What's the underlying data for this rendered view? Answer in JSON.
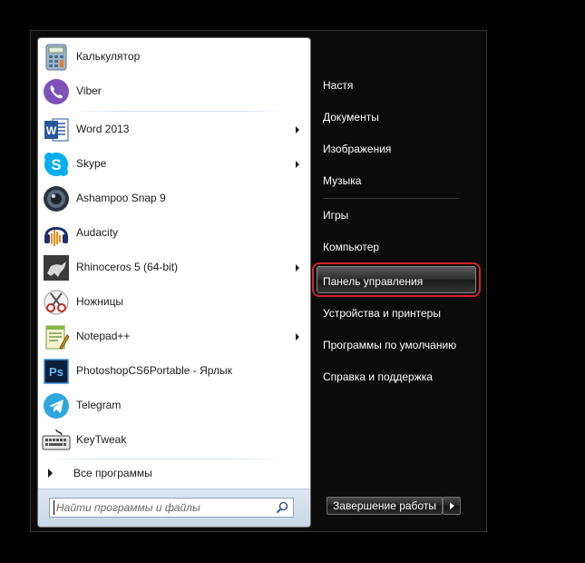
{
  "programs": [
    {
      "label": "Калькулятор",
      "icon": "calculator-icon",
      "submenu": false
    },
    {
      "label": "Viber",
      "icon": "viber-icon",
      "submenu": false
    },
    {
      "label": "Word 2013",
      "icon": "word-icon",
      "submenu": true
    },
    {
      "label": "Skype",
      "icon": "skype-icon",
      "submenu": true
    },
    {
      "label": "Ashampoo Snap 9",
      "icon": "ashampoo-snap-icon",
      "submenu": false
    },
    {
      "label": "Audacity",
      "icon": "audacity-icon",
      "submenu": false
    },
    {
      "label": "Rhinoceros 5 (64-bit)",
      "icon": "rhinoceros-icon",
      "submenu": true
    },
    {
      "label": "Ножницы",
      "icon": "scissors-icon",
      "submenu": false
    },
    {
      "label": "Notepad++",
      "icon": "notepad-plus-plus-icon",
      "submenu": true
    },
    {
      "label": "PhotoshopCS6Portable - Ярлык",
      "icon": "photoshop-icon",
      "submenu": false
    },
    {
      "label": "Telegram",
      "icon": "telegram-icon",
      "submenu": false
    },
    {
      "label": "KeyTweak",
      "icon": "keyboard-icon",
      "submenu": false
    }
  ],
  "all_programs_label": "Все программы",
  "search": {
    "placeholder": "Найти программы и файлы",
    "value": ""
  },
  "right_pane": {
    "items": [
      "Настя",
      "Документы",
      "Изображения",
      "Музыка",
      "Игры",
      "Компьютер",
      "Панель управления",
      "Устройства и принтеры",
      "Программы по умолчанию",
      "Справка и поддержка"
    ],
    "highlighted": "Панель управления"
  },
  "shutdown_label": "Завершение работы",
  "colors": {
    "highlight_ring": "#d2252f",
    "menu_background": "#0b0b0b",
    "left_pane_background": "#ffffff"
  }
}
